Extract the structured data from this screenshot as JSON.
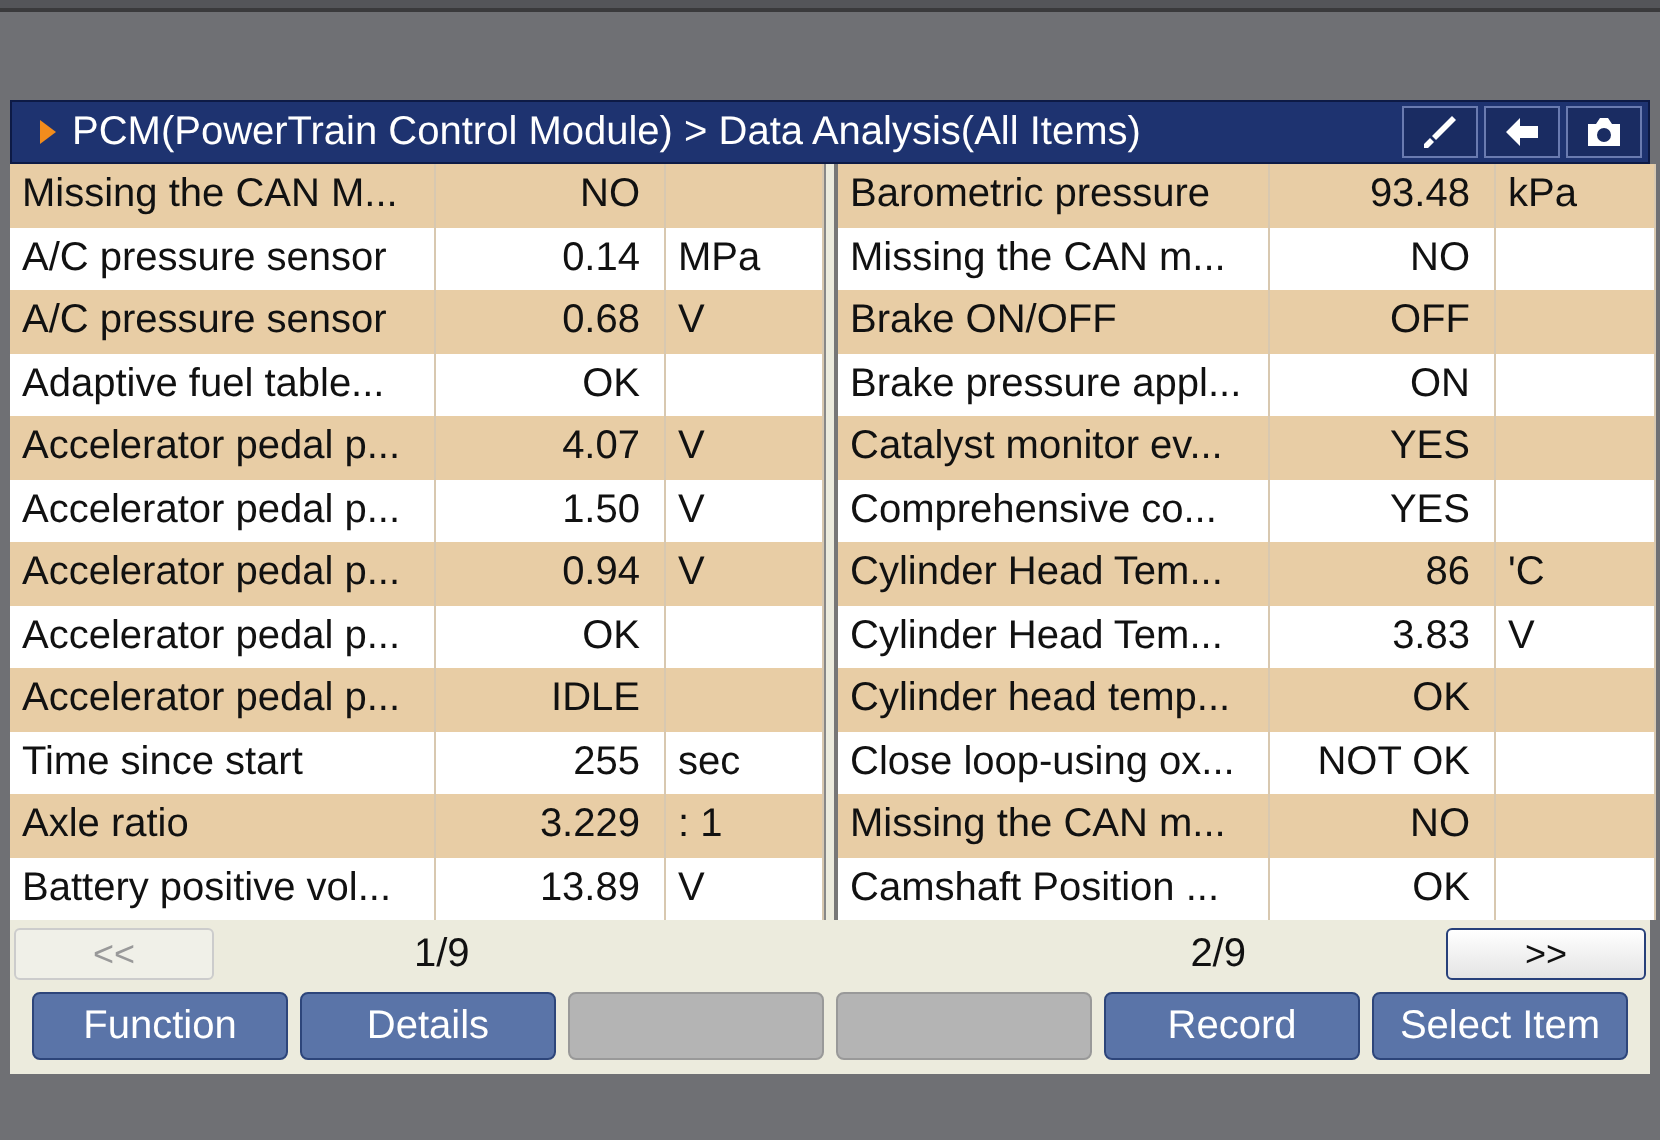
{
  "header": {
    "breadcrumb": "PCM(PowerTrain Control Module) > Data Analysis(All Items)"
  },
  "tables": [
    {
      "rows": [
        {
          "name": "Missing the CAN M...",
          "value": "NO"
        },
        {
          "name": "A/C pressure sensor",
          "value": "0.14",
          "unit": "MPa"
        },
        {
          "name": "A/C pressure sensor",
          "value": "0.68",
          "unit": "V"
        },
        {
          "name": "Adaptive fuel table...",
          "value": "OK"
        },
        {
          "name": "Accelerator pedal p...",
          "value": "4.07",
          "unit": "V"
        },
        {
          "name": "Accelerator pedal p...",
          "value": "1.50",
          "unit": "V"
        },
        {
          "name": "Accelerator pedal p...",
          "value": "0.94",
          "unit": "V"
        },
        {
          "name": "Accelerator pedal p...",
          "value": "OK"
        },
        {
          "name": "Accelerator pedal p...",
          "value": "IDLE"
        },
        {
          "name": "Time since start",
          "value": "255",
          "unit": "sec"
        },
        {
          "name": "Axle ratio",
          "value": "3.229",
          "unit": ": 1"
        },
        {
          "name": "Battery positive vol...",
          "value": "13.89",
          "unit": "V"
        }
      ],
      "page": "1/9"
    },
    {
      "rows": [
        {
          "name": "Barometric pressure",
          "value": "93.48",
          "unit": "kPa"
        },
        {
          "name": "Missing the CAN m...",
          "value": "NO"
        },
        {
          "name": "Brake ON/OFF",
          "value": "OFF"
        },
        {
          "name": "Brake pressure appl...",
          "value": "ON"
        },
        {
          "name": "Catalyst monitor ev...",
          "value": "YES"
        },
        {
          "name": "Comprehensive co...",
          "value": "YES"
        },
        {
          "name": "Cylinder Head Tem...",
          "value": "86",
          "unit": "'C"
        },
        {
          "name": "Cylinder Head Tem...",
          "value": "3.83",
          "unit": "V"
        },
        {
          "name": "Cylinder head temp...",
          "value": "OK"
        },
        {
          "name": "Close loop-using ox...",
          "value": "NOT OK"
        },
        {
          "name": "Missing the CAN m...",
          "value": "NO"
        },
        {
          "name": "Camshaft Position ...",
          "value": "OK"
        }
      ],
      "page": "2/9"
    }
  ],
  "pager": {
    "prev": {
      "label": "<<",
      "disabled": true
    },
    "next": {
      "label": ">>",
      "disabled": false
    }
  },
  "buttons": [
    {
      "label": "Function",
      "disabled": false
    },
    {
      "label": "Details",
      "disabled": false
    },
    {
      "disabled": true
    },
    {
      "disabled": true
    },
    {
      "label": "Record",
      "disabled": false
    },
    {
      "label": "Select Item",
      "disabled": false
    }
  ]
}
